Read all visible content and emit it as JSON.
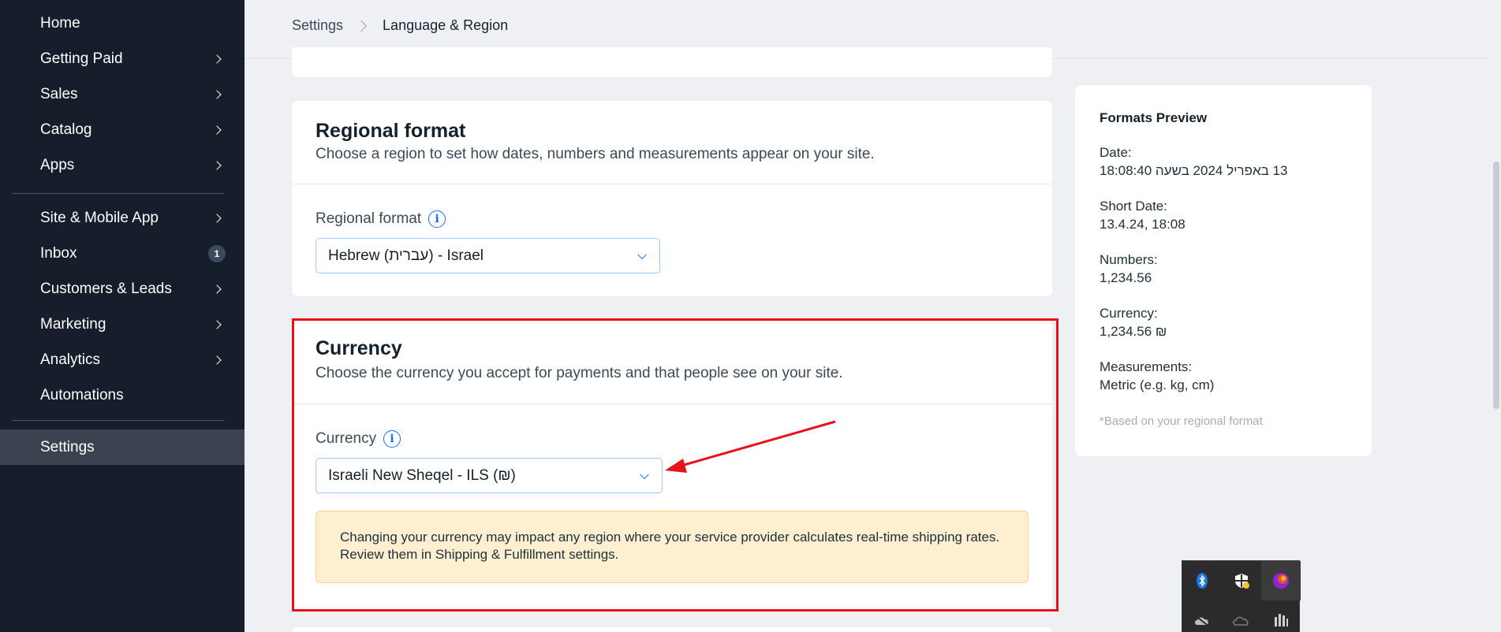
{
  "sidebar": {
    "items": [
      {
        "label": "Home",
        "chevron": false
      },
      {
        "label": "Getting Paid",
        "chevron": true
      },
      {
        "label": "Sales",
        "chevron": true
      },
      {
        "label": "Catalog",
        "chevron": true
      },
      {
        "label": "Apps",
        "chevron": true
      },
      {
        "label": "Site & Mobile App",
        "chevron": true
      },
      {
        "label": "Inbox",
        "badge": "1"
      },
      {
        "label": "Customers & Leads",
        "chevron": true
      },
      {
        "label": "Marketing",
        "chevron": true
      },
      {
        "label": "Analytics",
        "chevron": true
      },
      {
        "label": "Automations",
        "chevron": false
      },
      {
        "label": "Settings",
        "active": true
      }
    ]
  },
  "breadcrumb": {
    "root": "Settings",
    "current": "Language & Region"
  },
  "regional": {
    "title": "Regional format",
    "subtitle": "Choose a region to set how dates, numbers and measurements appear on your site.",
    "field_label": "Regional format",
    "selected": "Hebrew (עברית) - Israel"
  },
  "currency": {
    "title": "Currency",
    "subtitle": "Choose the currency you accept for payments and that people see on your site.",
    "field_label": "Currency",
    "selected": "Israeli New Sheqel - ILS (₪)",
    "warning": "Changing your currency may impact any region where your service provider calculates real-time shipping rates. Review them in Shipping & Fulfillment settings."
  },
  "preview": {
    "title": "Formats Preview",
    "date_label": "Date:",
    "date_value": "13 באפריל 2024 בשעה 18:08:40",
    "short_date_label": "Short Date:",
    "short_date_value": "13.4.24, 18:08",
    "numbers_label": "Numbers:",
    "numbers_value": "1,234.56",
    "currency_label": "Currency:",
    "currency_value": "‏1,234.56 ₪",
    "measurements_label": "Measurements:",
    "measurements_value": "Metric (e.g. kg, cm)",
    "note": "*Based on your regional format"
  },
  "colors": {
    "sidebar_bg": "#161d2b",
    "accent": "#116dff",
    "highlight": "#e8121b",
    "warning_bg": "#fdefcf"
  },
  "tray": {
    "icons": [
      "bluetooth-icon",
      "security-shield-icon",
      "app-orb-icon",
      "cloud-off-icon",
      "onedrive-icon",
      "audio-levels-icon"
    ]
  }
}
